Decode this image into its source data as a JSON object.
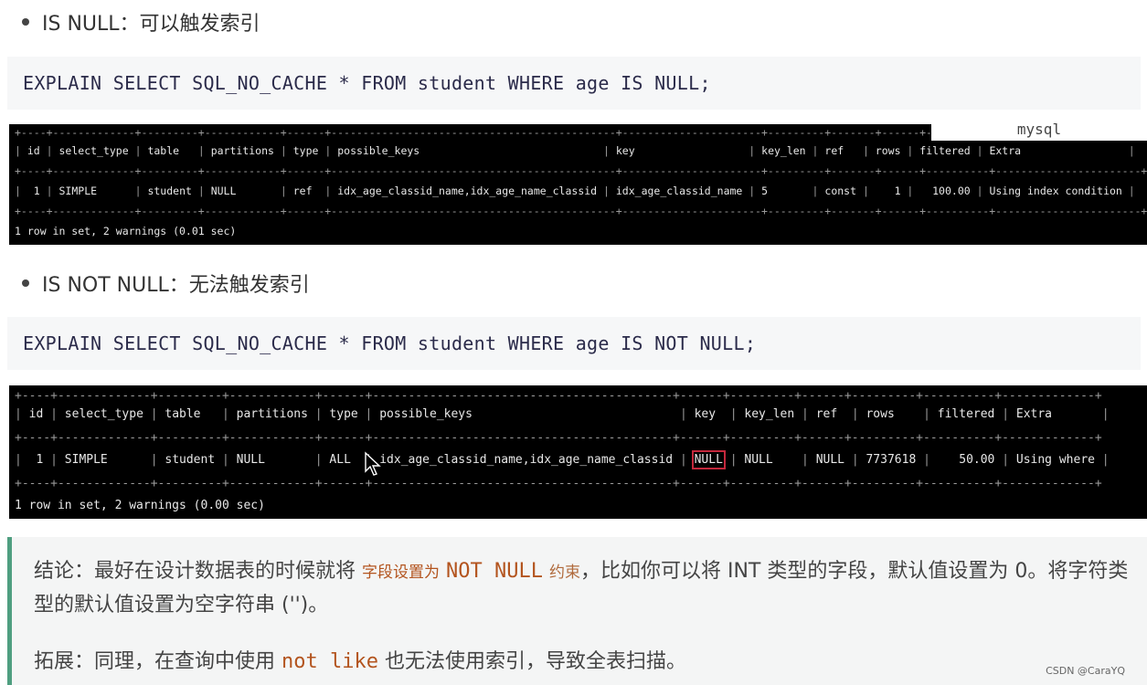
{
  "section1": {
    "bullet": "IS NULL：可以触发索引",
    "sql": "EXPLAIN SELECT SQL_NO_CACHE * FROM student WHERE age IS NULL;",
    "code_lang_label": "mysql",
    "result": {
      "headers": [
        "id",
        "select_type",
        "table",
        "partitions",
        "type",
        "possible_keys",
        "key",
        "key_len",
        "ref",
        "rows",
        "filtered",
        "Extra"
      ],
      "row": [
        "1",
        "SIMPLE",
        "student",
        "NULL",
        "ref",
        "idx_age_classid_name,idx_age_name_classid",
        "idx_age_classid_name",
        "5",
        "const",
        "1",
        "100.00",
        "Using index condition"
      ],
      "footer": "1 row in set, 2 warnings (0.01 sec)"
    }
  },
  "section2": {
    "bullet": "IS NOT NULL：无法触发索引",
    "sql": "EXPLAIN SELECT SQL_NO_CACHE * FROM student WHERE age IS NOT NULL;",
    "result": {
      "headers": [
        "id",
        "select_type",
        "table",
        "partitions",
        "type",
        "possible_keys",
        "key",
        "key_len",
        "ref",
        "rows",
        "filtered",
        "Extra"
      ],
      "row": [
        "1",
        "SIMPLE",
        "student",
        "NULL",
        "ALL",
        "idx_age_classid_name,idx_age_name_classid",
        "NULL",
        "NULL",
        "NULL",
        "7737618",
        "50.00",
        "Using where"
      ],
      "highlighted_cell": "key",
      "footer": "1 row in set, 2 warnings (0.00 sec)"
    }
  },
  "note": {
    "conclusion_prefix": "结论：最好在设计数据表的时候就将",
    "conclusion_small": "字段设置为",
    "conclusion_code": "NOT NULL",
    "conclusion_small2": "约束",
    "conclusion_rest": "，比如你可以将 INT 类型的字段，默认值设置为 0。将字符类型的默认值设置为空字符串 ('')。",
    "extension_prefix": "拓展：同理，在查询中使用",
    "extension_code": "not like",
    "extension_rest": "也无法使用索引，导致全表扫描。",
    "accent_color": "#4f9e80",
    "code_color": "#b3541e"
  },
  "watermark": "CSDN @CaraYQ"
}
